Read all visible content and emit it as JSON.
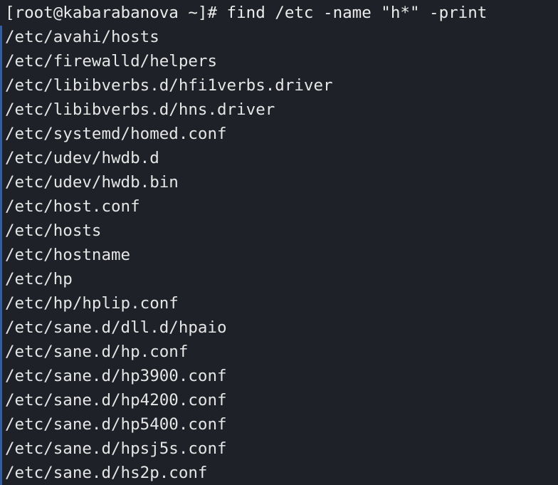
{
  "terminal": {
    "prompt": "[root@kabarabanova ~]# find /etc -name \"h*\" -print",
    "output": [
      "/etc/avahi/hosts",
      "/etc/firewalld/helpers",
      "/etc/libibverbs.d/hfi1verbs.driver",
      "/etc/libibverbs.d/hns.driver",
      "/etc/systemd/homed.conf",
      "/etc/udev/hwdb.d",
      "/etc/udev/hwdb.bin",
      "/etc/host.conf",
      "/etc/hosts",
      "/etc/hostname",
      "/etc/hp",
      "/etc/hp/hplip.conf",
      "/etc/sane.d/dll.d/hpaio",
      "/etc/sane.d/hp.conf",
      "/etc/sane.d/hp3900.conf",
      "/etc/sane.d/hp4200.conf",
      "/etc/sane.d/hp5400.conf",
      "/etc/sane.d/hpsj5s.conf",
      "/etc/sane.d/hs2p.conf"
    ]
  },
  "colors": {
    "background": "#1e2127",
    "foreground": "#e6e6e6",
    "scroll_indicator": "#2f5fa8"
  }
}
